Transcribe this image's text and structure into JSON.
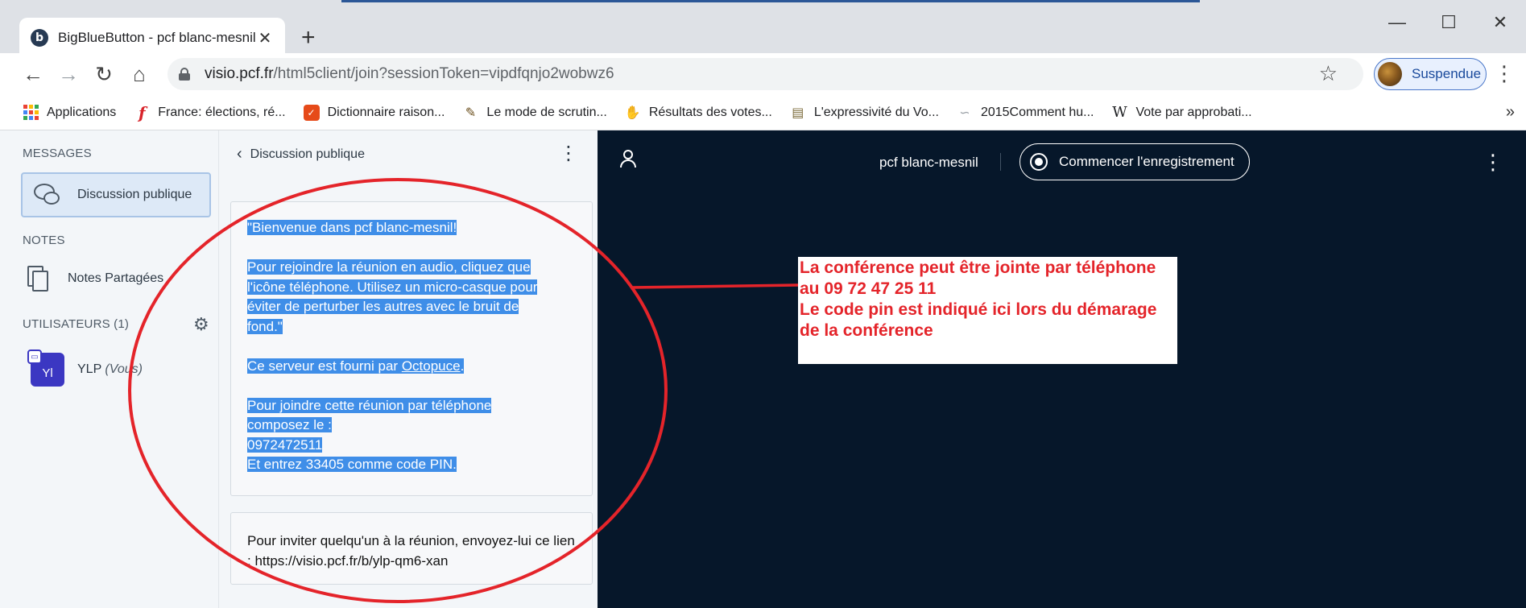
{
  "browser": {
    "tab": {
      "title": "BigBlueButton - pcf blanc-mesnil",
      "favicon_letter": "b"
    },
    "url_host": "visio.pcf.fr",
    "url_path": "/html5client/join?sessionToken=vipdfqnjo2wobwz6",
    "profile_label": "Suspendue",
    "bookmarks": [
      {
        "label": "Applications",
        "icon": "apps-grid-icon"
      },
      {
        "label": "France: élections, ré...",
        "icon": "f-logo-icon",
        "color": "#d8232a"
      },
      {
        "label": "Dictionnaire raison...",
        "icon": "dictionary-icon",
        "color": "#e64a19"
      },
      {
        "label": "Le mode de scrutin...",
        "icon": "ballot-icon",
        "color": "#6b4f1d"
      },
      {
        "label": "Résultats des votes...",
        "icon": "hand-icon",
        "color": "#3a2a10"
      },
      {
        "label": "L'expressivité du Vo...",
        "icon": "document-icon",
        "color": "#7b6a3a"
      },
      {
        "label": "2015Comment hu...",
        "icon": "signature-icon",
        "color": "#9aa0a6"
      },
      {
        "label": "Vote par approbati...",
        "icon": "wikipedia-icon",
        "color": "#202124"
      }
    ]
  },
  "sidebar": {
    "messages_title": "MESSAGES",
    "public_chat_label": "Discussion publique",
    "notes_title": "NOTES",
    "shared_notes_label": "Notes Partagées",
    "users_title": "UTILISATEURS (1)",
    "user": {
      "initials": "Yl",
      "name": "YLP",
      "you": "(Vous)"
    }
  },
  "chat": {
    "header_title": "Discussion publique",
    "welcome_lines": [
      "\"Bienvenue dans pcf blanc-mesnil!",
      "",
      "Pour rejoindre la réunion en audio, cliquez que",
      "l'icône téléphone. Utilisez un micro-casque pour",
      "éviter de perturber les autres avec le bruit de",
      "fond.\"",
      "",
      "Ce serveur est fourni par ",
      "",
      "Pour joindre cette réunion par téléphone",
      "composez le :",
      "0972472511",
      "Et entrez 33405 comme code PIN."
    ],
    "server_link": "Octopuce",
    "server_suffix": ".",
    "invite_text": "Pour inviter quelqu'un à la réunion, envoyez-lui ce lien : https://visio.pcf.fr/b/ylp-qm6-xan"
  },
  "presentation": {
    "meeting_name": "pcf blanc-mesnil",
    "record_label": "Commencer l'enregistrement"
  },
  "annotation": {
    "lines": [
      "La conférence peut être jointe par téléphone",
      "au 09 72 47 25 11",
      "Le code pin est indiqué ici lors du démarage",
      "de la conférence"
    ],
    "color": "#e4242a"
  },
  "colors": {
    "presentation_bg": "#06172a",
    "sidebar_bg": "#f3f6f9",
    "selection_highlight": "#3f8ee8",
    "user_avatar": "#3b37c2"
  }
}
